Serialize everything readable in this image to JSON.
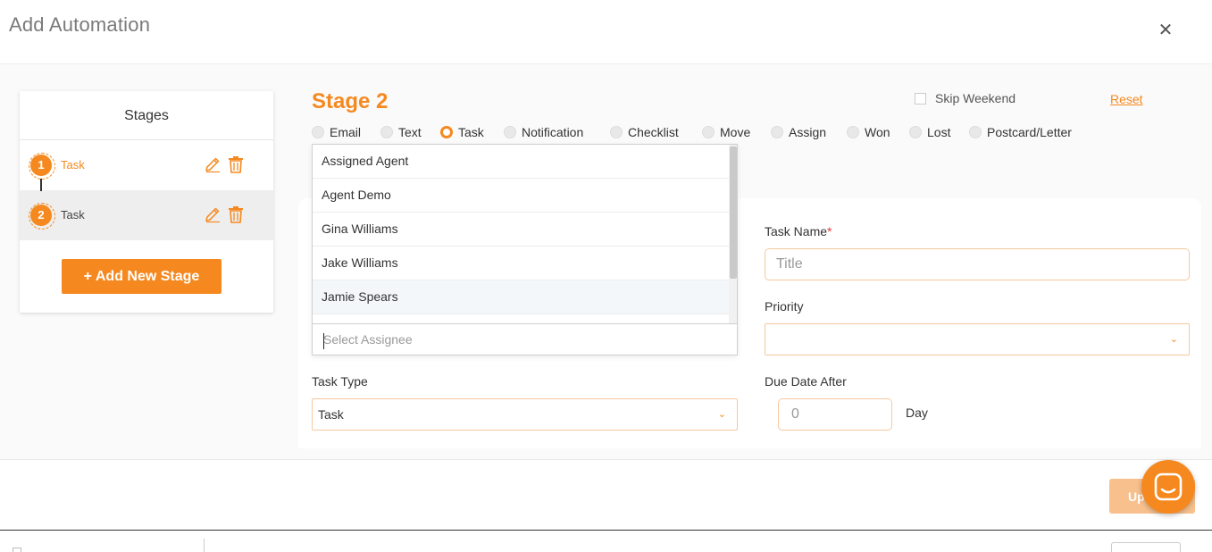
{
  "header": {
    "title": "Add Automation",
    "close_symbol": "✕"
  },
  "stages_panel": {
    "title": "Stages",
    "items": [
      {
        "number": "1",
        "label": "Task"
      },
      {
        "number": "2",
        "label": "Task"
      }
    ],
    "add_button_label": "+ Add New Stage"
  },
  "stage_editor": {
    "heading": "Stage 2",
    "skip_weekend_label": "Skip Weekend",
    "reset_label": "Reset",
    "action_types": [
      "Email",
      "Text",
      "Task",
      "Notification",
      "Checklist",
      "Move",
      "Assign",
      "Won",
      "Lost",
      "Postcard/Letter"
    ],
    "selected_action": "Task"
  },
  "assignee_dropdown": {
    "options": [
      "Assigned Agent",
      "Agent Demo",
      "Gina Williams",
      "Jake Williams",
      "Jamie Spears"
    ],
    "hovered_option": "Jamie Spears",
    "search_placeholder": "Select Assignee"
  },
  "form": {
    "task_name_label": "Task Name",
    "task_name_required": "*",
    "task_name_placeholder": "Title",
    "priority_label": "Priority",
    "priority_value": "",
    "task_type_label": "Task Type",
    "task_type_value": "Task",
    "due_date_label": "Due Date After",
    "due_date_placeholder": "0",
    "due_date_unit": "Day"
  },
  "footer": {
    "update_button_label": "Up"
  },
  "colors": {
    "accent": "#f5891f",
    "accent_light": "#f8c08d",
    "border_accent": "#f3c9a0"
  }
}
